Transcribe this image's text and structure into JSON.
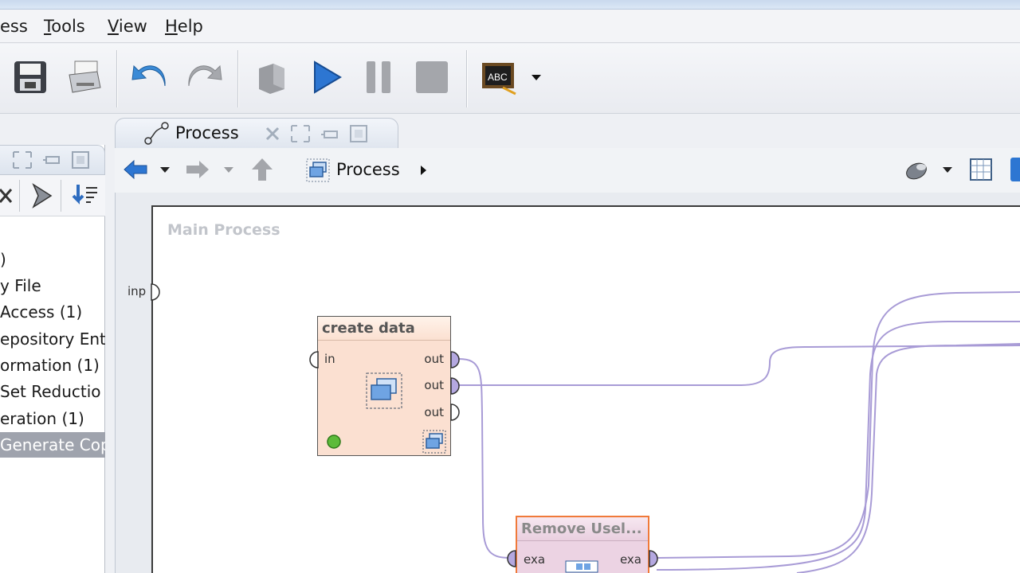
{
  "menu": {
    "items": [
      {
        "pre": "",
        "u": "",
        "post": "ess"
      },
      {
        "pre": "",
        "u": "T",
        "post": "ools"
      },
      {
        "pre": "",
        "u": "V",
        "post": "iew"
      },
      {
        "pre": "",
        "u": "H",
        "post": "elp"
      }
    ]
  },
  "toolbar": {
    "icons": [
      "save-icon",
      "print-icon",
      "undo-icon",
      "redo-icon",
      "breakpoint-icon",
      "run-icon",
      "pause-icon",
      "stop-icon",
      "spellcheck-icon",
      "dropdown-arrow-icon"
    ]
  },
  "left_panel": {
    "tree": [
      {
        "label": ")"
      },
      {
        "label": "y File"
      },
      {
        "label": "Access (1)"
      },
      {
        "label": "epository Entry"
      },
      {
        "label": "ormation (1)"
      },
      {
        "label": " Set Reductio"
      },
      {
        "label": "eration (1)"
      },
      {
        "label": "Generate Cop",
        "selected": true
      }
    ]
  },
  "process_tab": {
    "label": "Process"
  },
  "nav": {
    "breadcrumb": "Process"
  },
  "canvas": {
    "title": "Main Process",
    "input_port": "inp"
  },
  "operators": {
    "create_data": {
      "title": "create data",
      "in_port": "in",
      "out_ports": [
        "out",
        "out",
        "out"
      ]
    },
    "remove_useless": {
      "title": "Remove Usel...",
      "in_port": "exa",
      "out_port": "exa"
    }
  },
  "colors": {
    "wire": "#a89bd6",
    "operator_fill": "#fbe0d1",
    "selected_border": "#f07a3a",
    "port_fill": "#b4a8e0"
  }
}
